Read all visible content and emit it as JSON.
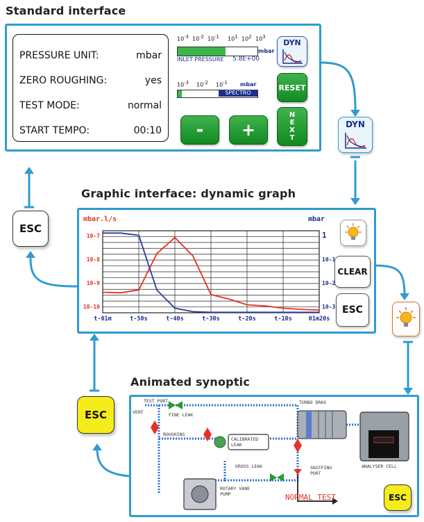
{
  "titles": {
    "standard": "Standard interface",
    "graphic": "Graphic interface: dynamic graph",
    "synoptic": "Animated synoptic"
  },
  "standard": {
    "rows": [
      {
        "label": "PRESSURE UNIT:",
        "value": "mbar"
      },
      {
        "label": "ZERO ROUGHING:",
        "value": "yes"
      },
      {
        "label": "TEST MODE:",
        "value": "normal"
      },
      {
        "label": "START TEMPO:",
        "value": "00:10"
      }
    ],
    "scale1_ticks": [
      "10-3",
      "10-2",
      "10-1",
      "10",
      "10",
      "10"
    ],
    "scale1_ticks_sup": [
      "",
      "",
      "",
      "1",
      "2",
      "3"
    ],
    "scale1_unit": "mbar",
    "scale1_fill": 0.6,
    "inlet_label": "INLET PRESSURE",
    "inlet_value": "5.8E+00",
    "scale2_ticks": [
      "10-3",
      "10-2",
      "10-1"
    ],
    "scale2_unit": "mbar",
    "scale2_fill": 0.05,
    "spectro_label": "SPECTRO",
    "dyn_label": "DYN",
    "reset_label": "RESET",
    "next_label": "NEXT",
    "minus_label": "-",
    "plus_label": "+"
  },
  "float_dyn_label": "DYN",
  "esc_left_label": "ESC",
  "esc_yellow_label": "ESC",
  "graph": {
    "y_unit_left": "mbar.l/s",
    "y_unit_right": "mbar",
    "left_ticks": [
      "10-7",
      "10-8",
      "10-9",
      "10-10"
    ],
    "right_ticks": [
      "1",
      "10-1",
      "10-2",
      "10-3"
    ],
    "x_ticks": [
      "t-01m",
      "t-50s",
      "t-40s",
      "t-30s",
      "t-20s",
      "t-10s",
      "01m20s"
    ],
    "clear_label": "CLEAR",
    "esc_label": "ESC"
  },
  "chart_data": {
    "type": "line",
    "x": [
      -60,
      -55,
      -50,
      -45,
      -40,
      -35,
      -30,
      -25,
      -20,
      -15,
      -10,
      -5,
      0
    ],
    "ylabel": "mbar.l/s",
    "series": [
      {
        "color": "#e83020",
        "values": [
          0.9,
          0.88,
          1.0,
          2.6,
          3.3,
          2.5,
          0.8,
          0.6,
          0.35,
          0.3,
          0.2,
          0.15,
          0.12
        ]
      },
      {
        "color": "#2a3a9a",
        "values": [
          3.5,
          3.5,
          3.4,
          1.0,
          0.2,
          0.05,
          0.02,
          0.02,
          0.02,
          0.02,
          0.02,
          0.02,
          0.02
        ]
      }
    ],
    "ylim": [
      0,
      3.6
    ],
    "grid": true
  },
  "synoptic": {
    "test_port": "TEST PORT",
    "vent": "VENT",
    "fine_leak": "FINE LEAK",
    "roughing": "ROUGHING",
    "calibrated_leak": "CALIBRATED\nLEAK",
    "gross_leak": "GROSS LEAK",
    "turbo_drag": "TURBO DRAG",
    "sniffing_port": "SNIFFING\nPORT",
    "analyser_cell": "ANALYSER CELL",
    "rotary_vane_pump": "ROTARY VANE\nPUMP",
    "status": "NORMAL TEST",
    "esc_label": "ESC"
  },
  "colors": {
    "accent": "#2f9bd0",
    "green": "#1f9a30",
    "yellow": "#f7ec1b",
    "red": "#e4322b"
  }
}
